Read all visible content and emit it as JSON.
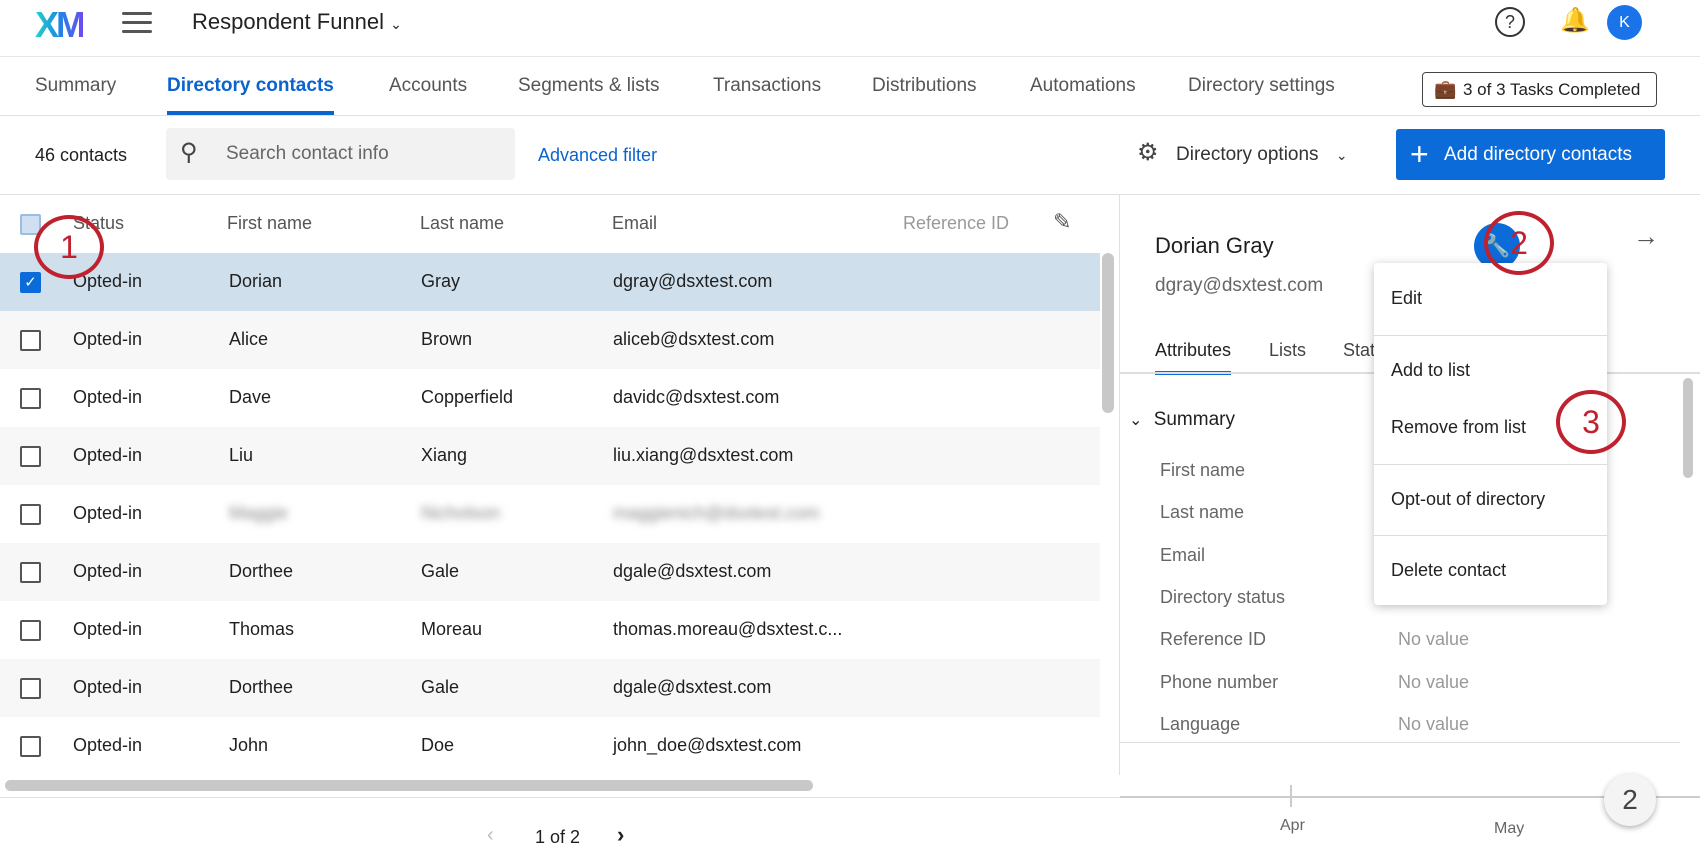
{
  "header": {
    "logo": "XM",
    "title": "Respondent Funnel",
    "help": "?",
    "avatar": "K"
  },
  "tabs": [
    "Summary",
    "Directory contacts",
    "Accounts",
    "Segments & lists",
    "Transactions",
    "Distributions",
    "Automations",
    "Directory settings"
  ],
  "tasks": "3 of 3 Tasks Completed",
  "toolbar": {
    "count": "46 contacts",
    "search_placeholder": "Search contact info",
    "advanced": "Advanced filter",
    "options": "Directory options",
    "add": "Add directory contacts"
  },
  "table": {
    "columns": [
      "Status",
      "First name",
      "Last name",
      "Email",
      "Reference ID"
    ],
    "rows": [
      {
        "status": "Opted-in",
        "first": "Dorian",
        "last": "Gray",
        "email": "dgray@dsxtest.com",
        "checked": true
      },
      {
        "status": "Opted-in",
        "first": "Alice",
        "last": "Brown",
        "email": "aliceb@dsxtest.com"
      },
      {
        "status": "Opted-in",
        "first": "Dave",
        "last": "Copperfield",
        "email": "davidc@dsxtest.com"
      },
      {
        "status": "Opted-in",
        "first": "Liu",
        "last": "Xiang",
        "email": "liu.xiang@dsxtest.com"
      },
      {
        "status": "Opted-in",
        "first": "Maggie",
        "last": "Nicholson",
        "email": "maggienich@dsxtest.com"
      },
      {
        "status": "Opted-in",
        "first": "Dorthee",
        "last": "Gale",
        "email": "dgale@dsxtest.com"
      },
      {
        "status": "Opted-in",
        "first": "Thomas",
        "last": "Moreau",
        "email": "thomas.moreau@dsxtest.c..."
      },
      {
        "status": "Opted-in",
        "first": "Dorthee",
        "last": "Gale",
        "email": "dgale@dsxtest.com"
      },
      {
        "status": "Opted-in",
        "first": "John",
        "last": "Doe",
        "email": "john_doe@dsxtest.com"
      }
    ]
  },
  "pagination": {
    "label": "1 of 2"
  },
  "panel": {
    "name": "Dorian Gray",
    "email": "dgray@dsxtest.com",
    "tabs": [
      "Attributes",
      "Lists",
      "Stat"
    ],
    "section": "Summary",
    "attributes": [
      {
        "label": "First name",
        "value": ""
      },
      {
        "label": "Last name",
        "value": ""
      },
      {
        "label": "Email",
        "value": ""
      },
      {
        "label": "Directory status",
        "value": ""
      },
      {
        "label": "Reference ID",
        "value": "No value"
      },
      {
        "label": "Phone number",
        "value": "No value"
      },
      {
        "label": "Language",
        "value": "No value"
      }
    ],
    "timeline": [
      "Apr",
      "May"
    ],
    "bubble": "2"
  },
  "menu": [
    "Edit",
    "Add to list",
    "Remove from list",
    "Opt-out of directory",
    "Delete contact"
  ],
  "annotations": [
    "1",
    "2",
    "3"
  ]
}
